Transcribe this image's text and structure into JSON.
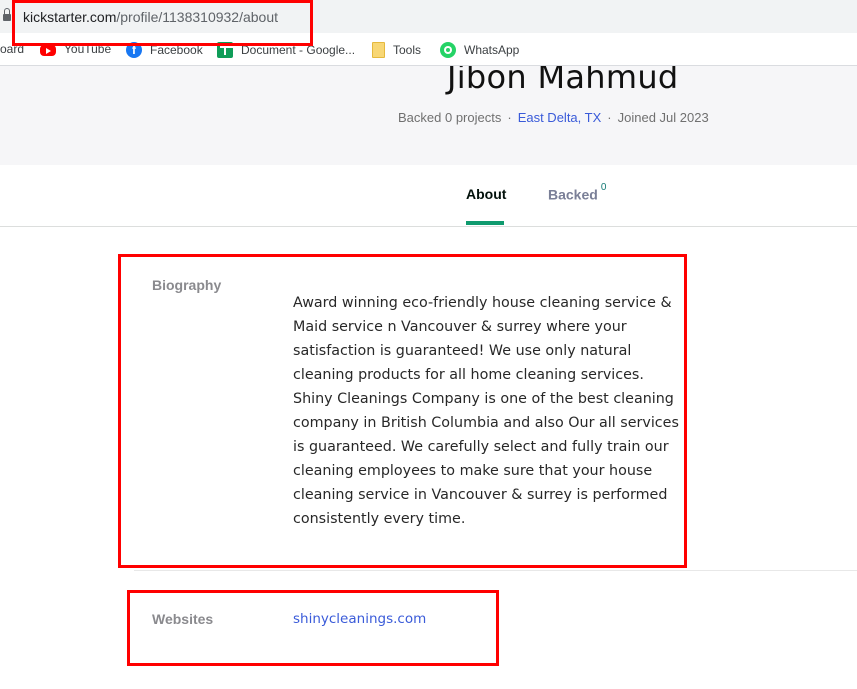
{
  "browser": {
    "url_host": "kickstarter.com",
    "url_path": "/profile/1138310932/about",
    "bookmarks": [
      {
        "label": "oard",
        "icon": "bookmark-partial"
      },
      {
        "label": "YouTube",
        "icon": "youtube-icon"
      },
      {
        "label": "Facebook",
        "icon": "facebook-icon"
      },
      {
        "label": "Document - Google...",
        "icon": "google-sheets-icon"
      },
      {
        "label": "Tools",
        "icon": "folder-icon"
      },
      {
        "label": "WhatsApp",
        "icon": "whatsapp-icon"
      }
    ]
  },
  "profile": {
    "name": "Jibon Mahmud",
    "backed_text": "Backed 0 projects",
    "separator": "·",
    "location": "East Delta, TX",
    "joined": "Joined Jul 2023"
  },
  "tabs": [
    {
      "label": "About",
      "active": true
    },
    {
      "label": "Backed",
      "count": "0",
      "active": false
    }
  ],
  "about": {
    "biography_label": "Biography",
    "biography_text": "Award winning eco-friendly house cleaning service & Maid service n Vancouver & surrey where your satisfaction is guaranteed! We use only natural cleaning products for all home cleaning services. Shiny Cleanings Company is one of the best cleaning company in British Columbia and also Our all services is guaranteed. We carefully select and fully train our cleaning employees to make sure that your house cleaning service in Vancouver & surrey is performed consistently every time.",
    "websites_label": "Websites",
    "website": "shinycleanings.com"
  },
  "colors": {
    "accent_tab": "#0f9a6e",
    "link": "#3a5bd9",
    "annotation": "#ff0000",
    "header_bg": "#f6f6f8"
  }
}
